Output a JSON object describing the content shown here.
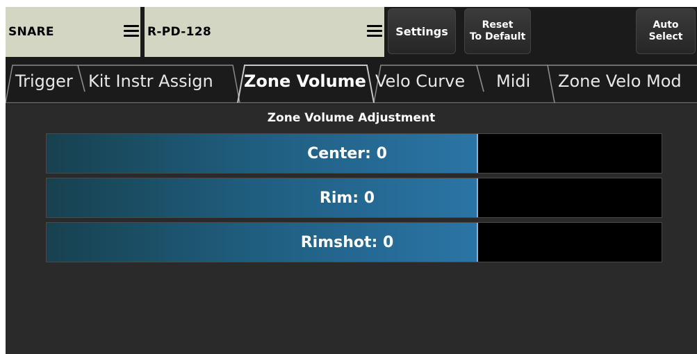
{
  "header": {
    "instrument": "SNARE",
    "pad": "R-PD-128",
    "settings_label": "Settings",
    "reset_label": "Reset\nTo Default",
    "auto_label": "Auto\nSelect"
  },
  "tabs": [
    {
      "label": "Trigger",
      "active": false
    },
    {
      "label": "Kit Instr Assign",
      "active": false
    },
    {
      "label": "Zone Volume",
      "active": true
    },
    {
      "label": "Velo Curve",
      "active": false
    },
    {
      "label": "Midi",
      "active": false
    },
    {
      "label": "Zone Velo Mod",
      "active": false
    }
  ],
  "panel": {
    "title": "Zone Volume Adjustment",
    "sliders": [
      {
        "text": "Center: 0",
        "level": 0.7
      },
      {
        "text": "Rim: 0",
        "level": 0.7
      },
      {
        "text": "Rimshot: 0",
        "level": 0.7
      }
    ]
  },
  "colors": {
    "selector_bg": "#d4d6c4",
    "background": "#2a2a2a",
    "slider_fill": "#2a75a6"
  }
}
